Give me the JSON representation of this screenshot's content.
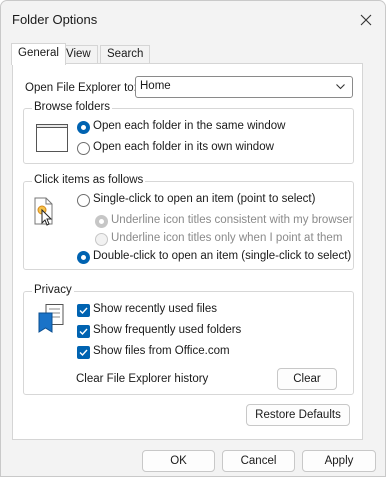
{
  "window": {
    "title": "Folder Options"
  },
  "tabs": [
    {
      "label": "General",
      "active": true
    },
    {
      "label": "View",
      "active": false
    },
    {
      "label": "Search",
      "active": false
    }
  ],
  "open_explorer": {
    "label": "Open File Explorer to:",
    "value": "Home"
  },
  "browse_folders": {
    "title": "Browse folders",
    "options": [
      {
        "label": "Open each folder in the same window",
        "checked": true
      },
      {
        "label": "Open each folder in its own window",
        "checked": false
      }
    ]
  },
  "click_items": {
    "title": "Click items as follows",
    "single_click": {
      "label": "Single-click to open an item (point to select)",
      "checked": false
    },
    "underline_consistent": {
      "label": "Underline icon titles consistent with my browser",
      "checked": true,
      "disabled": true
    },
    "underline_point": {
      "label": "Underline icon titles only when I point at them",
      "checked": false,
      "disabled": true
    },
    "double_click": {
      "label": "Double-click to open an item (single-click to select)",
      "checked": true
    }
  },
  "privacy": {
    "title": "Privacy",
    "checks": [
      {
        "label": "Show recently used files",
        "checked": true
      },
      {
        "label": "Show frequently used folders",
        "checked": true
      },
      {
        "label": "Show files from Office.com",
        "checked": true
      }
    ],
    "clear_history_label": "Clear File Explorer history",
    "clear_button": "Clear"
  },
  "restore_defaults": "Restore Defaults",
  "footer": {
    "ok": "OK",
    "cancel": "Cancel",
    "apply": "Apply"
  },
  "colors": {
    "accent": "#0063b1",
    "window_bg": "#f3f3f3",
    "panel_bg": "#ffffff"
  }
}
